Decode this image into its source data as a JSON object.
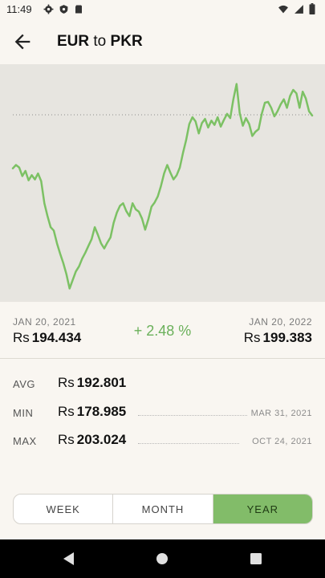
{
  "status_bar": {
    "time": "11:49"
  },
  "header": {
    "base": "EUR",
    "connector": "to",
    "quote": "PKR"
  },
  "chart_data": {
    "type": "line",
    "x": [
      "JAN 20, 2021",
      "JAN 20, 2022"
    ],
    "ylim": [
      178.0,
      204.0
    ],
    "reference_line": 199.383,
    "series": [
      {
        "values": [
          193.1,
          193.5,
          193.2,
          192.2,
          192.8,
          191.7,
          192.3,
          191.8,
          192.5,
          191.6,
          189.0,
          187.5,
          186.2,
          185.8,
          184.3,
          183.1,
          182.0,
          180.7,
          179.0,
          180.0,
          181.0,
          181.6,
          182.5,
          183.2,
          184.0,
          184.8,
          186.2,
          185.3,
          184.3,
          183.7,
          184.4,
          185.0,
          186.7,
          187.9,
          188.7,
          189.0,
          188.1,
          187.5,
          189.0,
          188.3,
          188.0,
          187.2,
          185.9,
          187.1,
          188.6,
          189.1,
          189.8,
          191.0,
          192.5,
          193.5,
          192.6,
          191.8,
          192.3,
          193.2,
          194.9,
          196.4,
          198.3,
          199.1,
          198.6,
          197.2,
          198.4,
          198.9,
          197.9,
          198.7,
          198.2,
          199.1,
          198.0,
          198.8,
          199.5,
          199.0,
          201.2,
          203.0,
          199.6,
          198.1,
          199.0,
          198.3,
          196.9,
          197.4,
          197.7,
          199.5,
          200.8,
          200.9,
          200.2,
          199.2,
          199.8,
          200.6,
          201.2,
          200.2,
          201.6,
          202.3,
          201.9,
          200.2,
          202.1,
          201.3,
          199.8,
          199.3
        ]
      }
    ]
  },
  "summary": {
    "start_date": "JAN 20, 2021",
    "start_currency": "Rs",
    "start_value": "194.434",
    "change": "+ 2.48 %",
    "end_date": "JAN 20, 2022",
    "end_currency": "Rs",
    "end_value": "199.383"
  },
  "stats": {
    "avg": {
      "label": "AVG",
      "currency": "Rs",
      "value": "192.801"
    },
    "min": {
      "label": "MIN",
      "currency": "Rs",
      "value": "178.985",
      "date": "MAR 31, 2021"
    },
    "max": {
      "label": "MAX",
      "currency": "Rs",
      "value": "203.024",
      "date": "OCT 24, 2021"
    }
  },
  "range_selector": {
    "options": [
      "WEEK",
      "MONTH",
      "YEAR"
    ],
    "selected": "YEAR"
  },
  "colors": {
    "accent": "#6ab05a",
    "line": "#7cc164",
    "chart_bg": "#e7e5e0",
    "segment_active": "#82bc69"
  }
}
